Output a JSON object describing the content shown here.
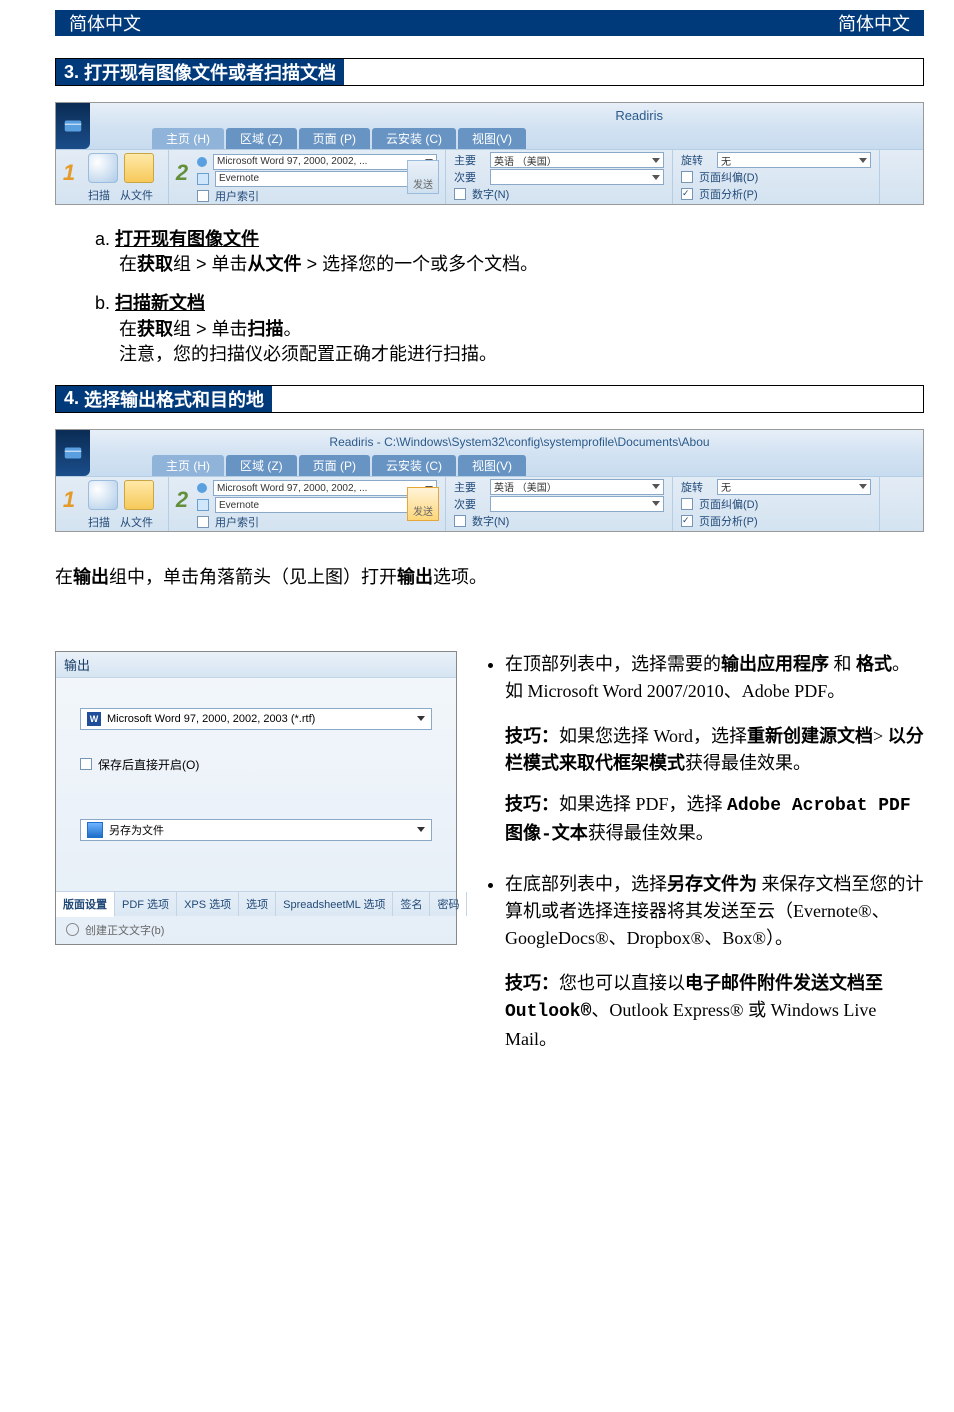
{
  "header": {
    "lang_left": "简体中文",
    "lang_right": "简体中文"
  },
  "section3": {
    "number": "3.",
    "title": "打开现有图像文件或者扫描文档"
  },
  "ribbon1": {
    "app_title": "Readiris",
    "tabs": {
      "home": "主页 (H)",
      "zone": "区域 (Z)",
      "page": "页面 (P)",
      "cloud": "云安装 (C)",
      "view": "视图(V)"
    },
    "scan_group": {
      "scan": "扫描",
      "from_file": "从文件"
    },
    "output_group": {
      "format": "Microsoft Word 97, 2000, 2002, ...",
      "dest": "Evernote",
      "user_index": "用户索引",
      "send": "发送"
    },
    "lang_group": {
      "primary_label": "主要",
      "primary_value": "英语 （美国）",
      "secondary_label": "次要",
      "digits": "数字(N)"
    },
    "rot_group": {
      "rotate_label": "旋转",
      "rotate_value": "无",
      "deskew": "页面纠偏(D)",
      "analyze": "页面分析(P)"
    }
  },
  "step3a": {
    "letter": "a.",
    "title": "打开现有图像文件",
    "line_pre": "在",
    "line_bold1": "获取",
    "line_mid1": "组 ",
    "chev": ">",
    "line_mid2": "  单击",
    "line_bold2": "从文件",
    "line_mid3": " ",
    "line_tail": "  选择您的一个或多个文档。"
  },
  "step3b": {
    "letter": "b.",
    "title": "扫描新文档",
    "l1_pre": "在",
    "l1_b1": "获取",
    "l1_mid": "组 ",
    "chev": ">",
    "l1_mid2": "  单击",
    "l1_b2": "扫描",
    "l1_tail": "。",
    "l2": "注意，您的扫描仪必须配置正确才能进行扫描。"
  },
  "section4": {
    "number": "4.",
    "title": "选择输出格式和目的地"
  },
  "ribbon2": {
    "app_title": "Readiris - C:\\Windows\\System32\\config\\systemprofile\\Documents\\Abou",
    "send": "发送"
  },
  "para_output": {
    "pre": "在",
    "b1": "输出",
    "mid": "组中，单击角落箭头（见上图）打开",
    "b2": "输出",
    "tail": "选项。"
  },
  "dialog": {
    "title": "输出",
    "format": "Microsoft Word 97, 2000, 2002, 2003 (*.rtf)",
    "open_after": "保存后直接开启(O)",
    "save_as": "另存为文件",
    "tabs": {
      "layout": "版面设置",
      "pdf": "PDF 选项",
      "xps": "XPS 选项",
      "opts": "选项",
      "sml": "SpreadsheetML 选项",
      "sign": "签名",
      "pwd": "密码"
    },
    "bottom": "创建正文文字(b)"
  },
  "right": {
    "bullet1_pre": "在顶部列表中，选择需要的",
    "bullet1_b1": "输出应用程序",
    "bullet1_mid": " 和 ",
    "bullet1_b2": "格式",
    "bullet1_tail": "。如 Microsoft Word 2007/2010、Adobe PDF。",
    "tip1_label": "技巧：",
    "tip1_pre": "如果您选择 Word，选择",
    "tip1_b1": "重新创建源文档",
    "tip1_mid": "> ",
    "tip1_b2": "以分栏模式来取代框架模式",
    "tip1_tail": "获得最佳效果。",
    "tip2_label": "技巧：",
    "tip2_pre": "如果选择 PDF，选择 ",
    "tip2_b": "Adobe Acrobat PDF 图像-文本",
    "tip2_tail": "获得最佳效果。",
    "bullet2_pre": "在底部列表中，选择",
    "bullet2_b": "另存文件为",
    "bullet2_tail": " 来保存文档至您的计算机或者选择连接器将其发送至云（Evernote®、GoogleDocs®、Dropbox®、Box®）。",
    "tip3_label": "技巧：",
    "tip3_pre": "您也可以直接以",
    "tip3_b1": "电子邮件附件发送文档至",
    "tip3_mid": " ",
    "tip3_b2": "Outlook®",
    "tip3_mid2": "、Outlook Express® 或 Windows Live Mail。"
  }
}
